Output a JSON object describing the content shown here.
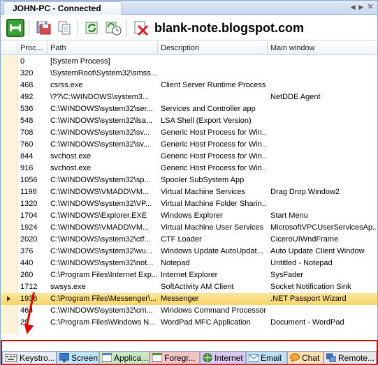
{
  "window": {
    "tab_title": "JOHN-PC - Connected",
    "watermark": "blank-note.blogspot.com"
  },
  "toolbar": {
    "buttons": [
      "connect-icon",
      "save-icon",
      "copy-icon",
      "refresh-icon",
      "refresh-schedule-icon",
      "delete-icon"
    ]
  },
  "grid": {
    "columns": [
      "Proc...",
      "Path",
      "Description",
      "Main window"
    ],
    "rows": [
      {
        "pid": "0",
        "path": "[System Process]",
        "desc": "",
        "main": ""
      },
      {
        "pid": "320",
        "path": "\\SystemRoot\\System32\\smss...",
        "desc": "",
        "main": ""
      },
      {
        "pid": "468",
        "path": "csrss.exe",
        "desc": "Client Server Runtime Process",
        "main": ""
      },
      {
        "pid": "492",
        "path": "\\??\\C:\\WINDOWS\\system3...",
        "desc": "",
        "main": "NetDDE Agent"
      },
      {
        "pid": "536",
        "path": "C:\\WINDOWS\\system32\\ser...",
        "desc": "Services and Controller app",
        "main": ""
      },
      {
        "pid": "548",
        "path": "C:\\WINDOWS\\system32\\lsa...",
        "desc": "LSA Shell (Export Version)",
        "main": ""
      },
      {
        "pid": "708",
        "path": "C:\\WINDOWS\\system32\\sv...",
        "desc": "Generic Host Process for Win...",
        "main": ""
      },
      {
        "pid": "760",
        "path": "C:\\WINDOWS\\system32\\sv...",
        "desc": "Generic Host Process for Win...",
        "main": ""
      },
      {
        "pid": "844",
        "path": "svchost.exe",
        "desc": "Generic Host Process for Win...",
        "main": ""
      },
      {
        "pid": "916",
        "path": "svchost.exe",
        "desc": "Generic Host Process for Win...",
        "main": ""
      },
      {
        "pid": "1056",
        "path": "C:\\WINDOWS\\system32\\sp...",
        "desc": "Spooler SubSystem App",
        "main": ""
      },
      {
        "pid": "1196",
        "path": "C:\\WINDOWS\\VMADD\\VM...",
        "desc": "Virtual Machine Services",
        "main": "Drag Drop Window2"
      },
      {
        "pid": "1320",
        "path": "C:\\WINDOWS\\system32\\VP...",
        "desc": "Virtual Machine Folder Sharin...",
        "main": ""
      },
      {
        "pid": "1704",
        "path": "C:\\WINDOWS\\Explorer.EXE",
        "desc": "Windows Explorer",
        "main": "Start Menu"
      },
      {
        "pid": "1924",
        "path": "C:\\WINDOWS\\VMADD\\VM...",
        "desc": "Virtual Machine User Services",
        "main": "MicrosoftVPCUserServicesAp..."
      },
      {
        "pid": "2020",
        "path": "C:\\WINDOWS\\system32\\ctf...",
        "desc": "CTF Loader",
        "main": "CiceroUIWndFrame"
      },
      {
        "pid": "376",
        "path": "C:\\WINDOWS\\system32\\wu...",
        "desc": "Windows Update AutoUpdat...",
        "main": "Auto Update Client Window"
      },
      {
        "pid": "440",
        "path": "C:\\WINDOWS\\system32\\not...",
        "desc": "Notepad",
        "main": "Untitled - Notepad"
      },
      {
        "pid": "260",
        "path": "C:\\Program Files\\Internet Exp...",
        "desc": "Internet Explorer",
        "main": "SysFader"
      },
      {
        "pid": "1712",
        "path": "swsys.exe",
        "desc": "SoftActivity AM Client",
        "main": "Socket Notification Sink"
      },
      {
        "pid": "1936",
        "path": "C:\\Program Files\\Messenger\\...",
        "desc": "Messenger",
        "main": ".NET Passport Wizard"
      },
      {
        "pid": "464",
        "path": "C:\\WINDOWS\\system32\\cm...",
        "desc": "Windows Command Processor",
        "main": ""
      },
      {
        "pid": "29",
        "path": "C:\\Program Files\\Windows N...",
        "desc": "WordPad MFC Application",
        "main": "Document - WordPad"
      }
    ]
  },
  "bottom_tabs": [
    {
      "label": "Keystro...",
      "icon": "keyboard-icon"
    },
    {
      "label": "Screen",
      "icon": "monitor-icon"
    },
    {
      "label": "Applica...",
      "icon": "window-icon"
    },
    {
      "label": "Foregr...",
      "icon": "foreground-window-icon"
    },
    {
      "label": "Internet",
      "icon": "globe-icon"
    },
    {
      "label": "Email",
      "icon": "envelope-icon"
    },
    {
      "label": "Chat",
      "icon": "chat-bubble-icon"
    },
    {
      "label": "Remote...",
      "icon": "remote-computer-icon"
    }
  ],
  "colors": {
    "selected_row": "#fbd56b",
    "annotation_red": "#e00000",
    "tab_header": "#c9d9f0"
  }
}
